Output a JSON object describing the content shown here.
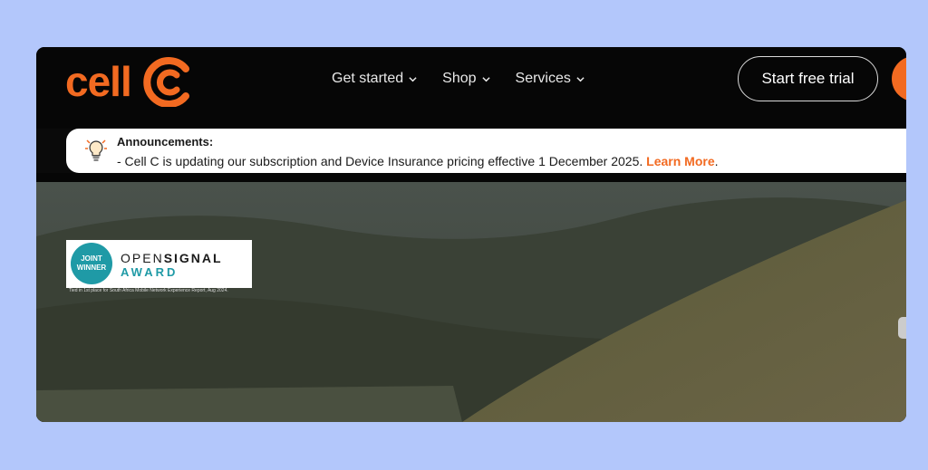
{
  "brand": {
    "logo_text": "cell",
    "accent": "#f26a21"
  },
  "nav": {
    "items": [
      {
        "label": "Get started",
        "icon": "chevron-down-icon"
      },
      {
        "label": "Shop",
        "icon": "chevron-down-icon"
      },
      {
        "label": "Services",
        "icon": "chevron-down-icon"
      }
    ],
    "trial_label": "Start free trial"
  },
  "announcement": {
    "title": "Announcements:",
    "text": "- Cell C is updating our subscription and Device Insurance pricing effective 1 December 2025. ",
    "link": "Learn More",
    "suffix": ".",
    "icon": "lightbulb-icon"
  },
  "award": {
    "badge_line1": "JOINT",
    "badge_line2": "WINNER",
    "title_open": "OPEN",
    "title_signal": "SIGNAL",
    "subtitle": "AWARD",
    "caption": "Tied in 1st place for South Africa Mobile Network Experience Report, Aug 2024."
  },
  "colors": {
    "page_bg": "#b3c7fb",
    "header_bg": "#060606",
    "award_teal": "#1f9aa6"
  }
}
